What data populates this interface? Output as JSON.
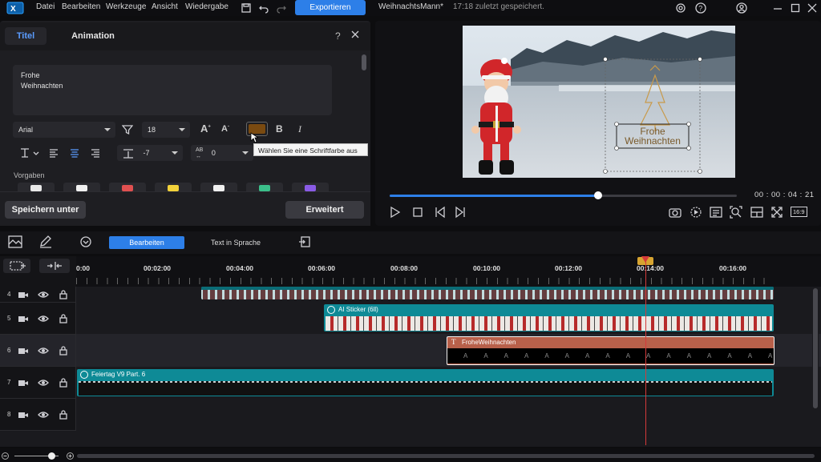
{
  "menu": {
    "items": [
      "Datei",
      "Bearbeiten",
      "Werkzeuge",
      "Ansicht",
      "Wiedergabe"
    ],
    "export_label": "Exportieren",
    "project_name": "WeihnachtsMann*",
    "save_status": "17:18 zuletzt gespeichert."
  },
  "editor": {
    "tabs": [
      "Titel",
      "Animation"
    ],
    "active_tab": "Titel",
    "text_line1": "Frohe",
    "text_line2": "Weihnachten",
    "font_family": "Arial",
    "font_size": "18",
    "line_spacing": "7",
    "char_spacing": "0",
    "tooltip": "Wählen Sie eine Schriftfarbe aus",
    "presets_label": "Vorgaben",
    "save_under_label": "Speichern unter",
    "advanced_label": "Erweitert",
    "font_color": "#7a4a10",
    "preset_colors": [
      "#e8e8e8",
      "#f0f0f0",
      "#e05050",
      "#f2d23a",
      "#f0f0f0",
      "#3bbf8a",
      "#8a5be6"
    ]
  },
  "preview": {
    "title_text_line1": "Frohe",
    "title_text_line2": "Weihnachten",
    "timecode": "00 : 00 : 04 : 21",
    "aspect": "16:9",
    "progress": 0.6
  },
  "timeline": {
    "tools": [
      "Bearbeiten",
      "Text in Sprache"
    ],
    "ruler_labels": [
      "0:00",
      "00:02:00",
      "00:04:00",
      "00:06:00",
      "00:08:00",
      "00:10:00",
      "00:12:00",
      "00:14:00",
      "00:16:00"
    ],
    "tracks": [
      {
        "num": "4",
        "clip": ""
      },
      {
        "num": "5",
        "clip": "AI Sticker (6ll)"
      },
      {
        "num": "6",
        "clip": "FroheWeihnachten"
      },
      {
        "num": "7",
        "clip": "Feiertag V9 Part. 6"
      },
      {
        "num": "8",
        "clip": ""
      }
    ],
    "colors": {
      "accent": "#2d7fe8",
      "video_clip": "#0e8a96",
      "title_clip": "#b8604a",
      "playhead": "#d43a3a"
    }
  }
}
